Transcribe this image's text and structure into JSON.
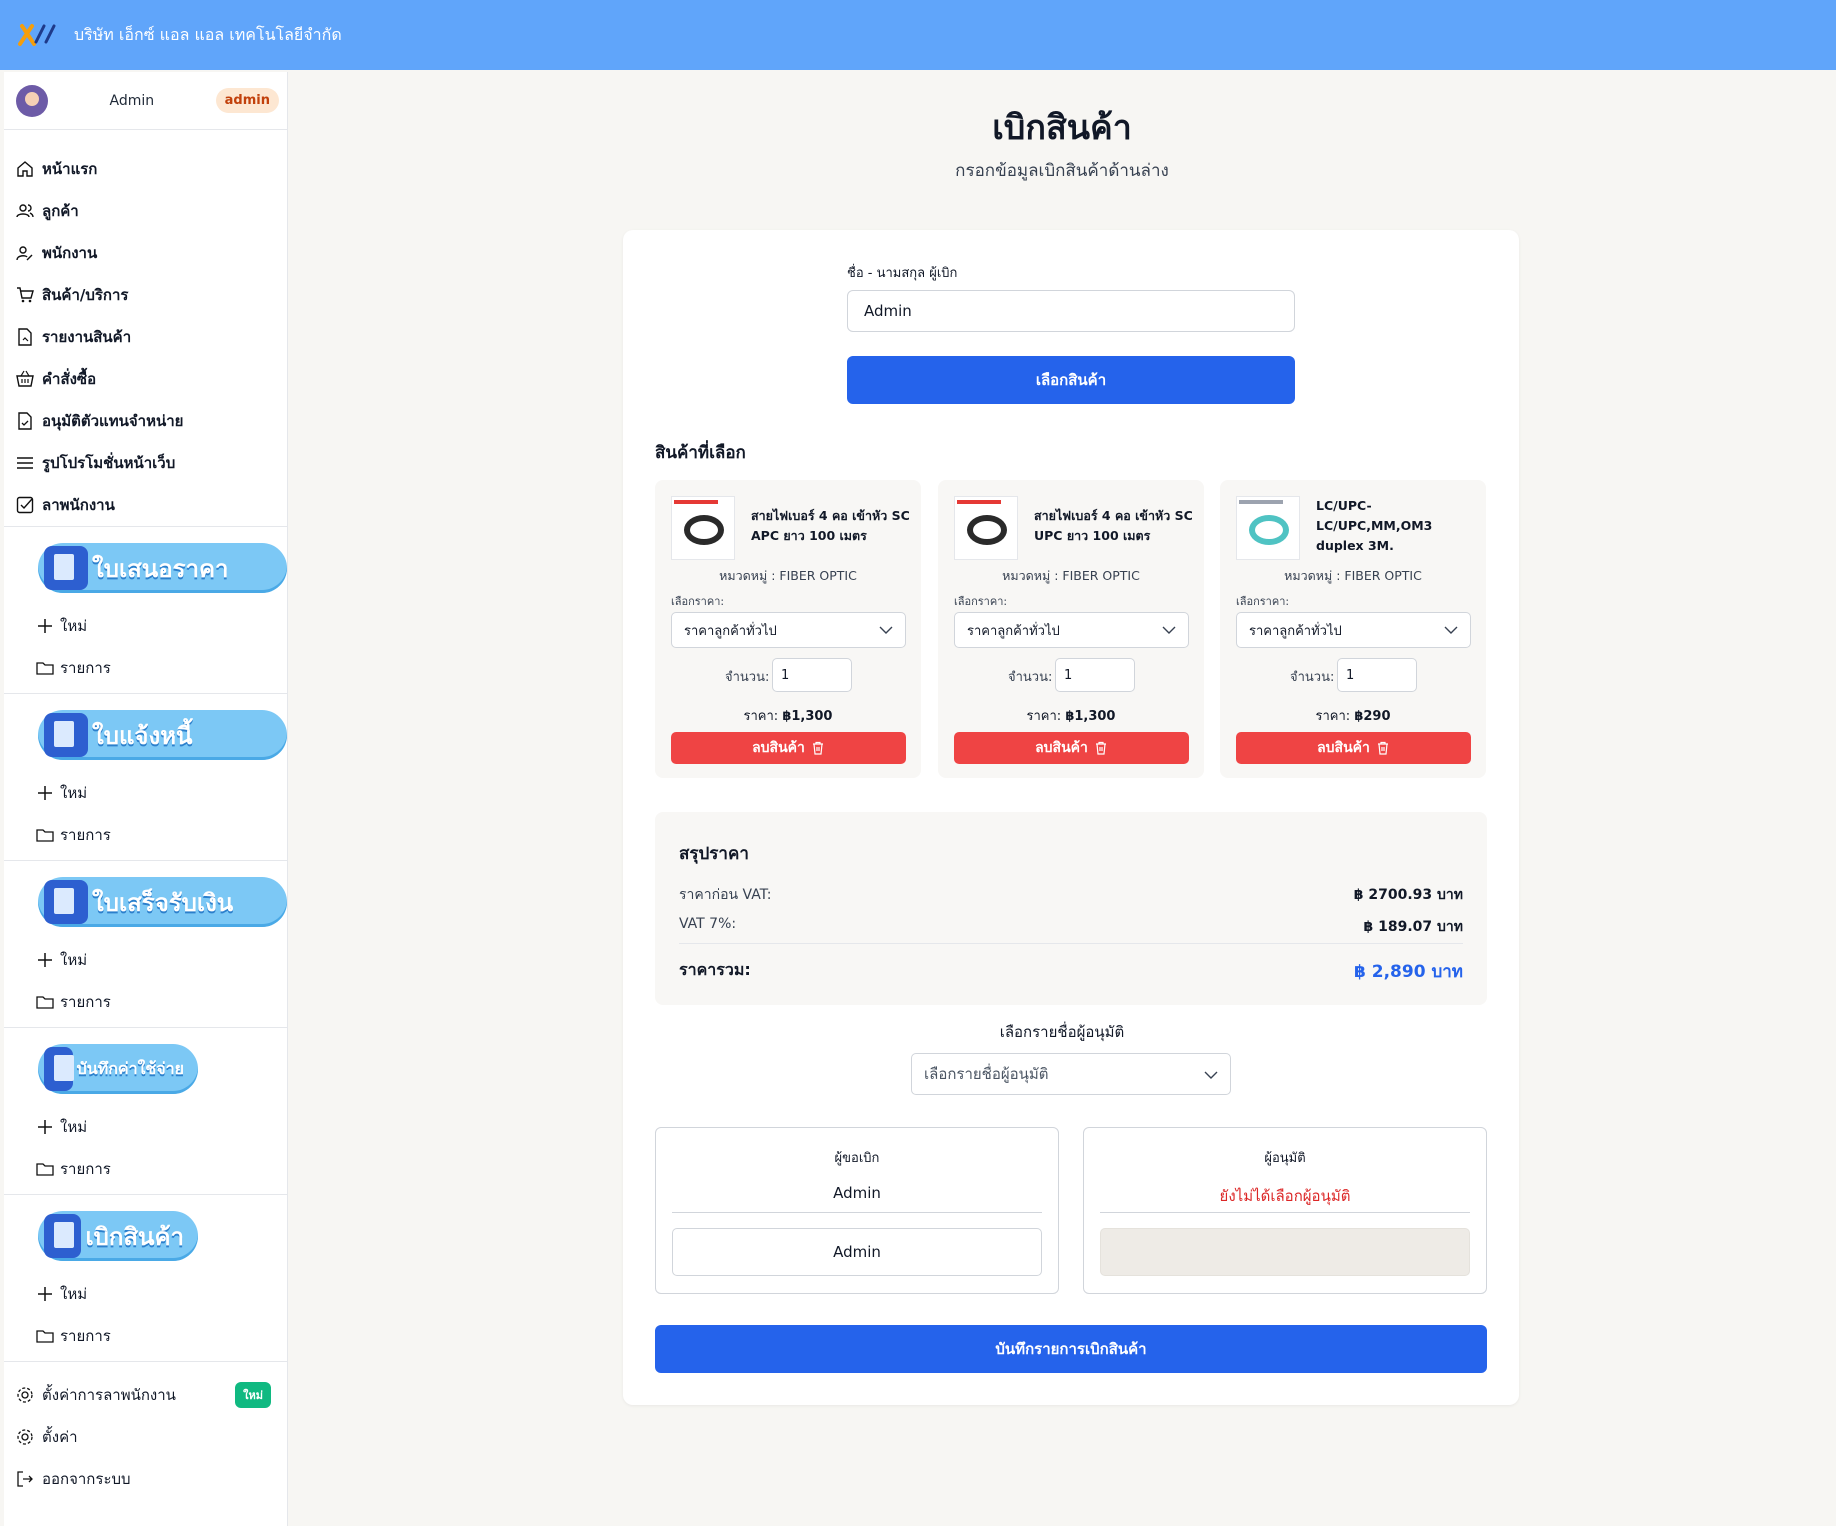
{
  "header": {
    "company_name": "บริษัท เอ็กซ์ แอล แอล เทคโนโลยีจำกัด"
  },
  "sidebar": {
    "user": {
      "name": "Admin",
      "role": "admin"
    },
    "nav": [
      {
        "label": "หน้าแรก",
        "icon": "home-icon"
      },
      {
        "label": "ลูกค้า",
        "icon": "users-icon"
      },
      {
        "label": "พนักงาน",
        "icon": "user-edit-icon"
      },
      {
        "label": "สินค้า/บริการ",
        "icon": "cart-icon"
      },
      {
        "label": "รายงานสินค้า",
        "icon": "file-report-icon"
      },
      {
        "label": "คำสั่งซื้อ",
        "icon": "basket-icon"
      },
      {
        "label": "อนุมัติตัวแทนจำหน่าย",
        "icon": "file-check-icon"
      },
      {
        "label": "รูปโปรโมชั่นหน้าเว็บ",
        "icon": "menu-icon"
      },
      {
        "label": "ลาพนักงาน",
        "icon": "checkbox-icon"
      }
    ],
    "sections": [
      {
        "banner": "ใบเสนอราคา",
        "new_label": "ใหม่",
        "list_label": "รายการ"
      },
      {
        "banner": "ใบแจ้งหนี้",
        "new_label": "ใหม่",
        "list_label": "รายการ"
      },
      {
        "banner": "ใบเสร็จรับเงิน",
        "new_label": "ใหม่",
        "list_label": "รายการ"
      },
      {
        "banner": "บันทึกค่าใช้จ่าย",
        "new_label": "ใหม่",
        "list_label": "รายการ"
      },
      {
        "banner": "เบิกสินค้า",
        "new_label": "ใหม่",
        "list_label": "รายการ"
      }
    ],
    "bottom": {
      "leave_settings": "ตั้งค่าการลาพนักงาน",
      "new_badge": "ใหม่",
      "settings": "ตั้งค่า",
      "logout": "ออกจากระบบ"
    }
  },
  "main": {
    "title": "เบิกสินค้า",
    "subtitle": "กรอกข้อมูลเบิกสินค้าด้านล่าง",
    "requester_label": "ชื่อ - นามสกุล ผู้เบิก",
    "requester_value": "Admin",
    "select_products_button": "เลือกสินค้า",
    "selected_title": "สินค้าที่เลือก",
    "products": [
      {
        "name": "สายไฟเบอร์ 4 คอ เข้าหัว SC APC ยาว 100 เมตร",
        "category": "หมวดหมู่ : FIBER OPTIC",
        "price_label": "เลือกราคา:",
        "price_option": "ราคาลูกค้าทั่วไป",
        "qty_label": "จำนวน:",
        "qty": "1",
        "price_prefix": "ราคา:",
        "price": "฿1,300",
        "delete_label": "ลบสินค้า"
      },
      {
        "name": "สายไฟเบอร์ 4 คอ เข้าหัว SC UPC ยาว 100 เมตร",
        "category": "หมวดหมู่ : FIBER OPTIC",
        "price_label": "เลือกราคา:",
        "price_option": "ราคาลูกค้าทั่วไป",
        "qty_label": "จำนวน:",
        "qty": "1",
        "price_prefix": "ราคา:",
        "price": "฿1,300",
        "delete_label": "ลบสินค้า"
      },
      {
        "name": "LC/UPC-LC/UPC,MM,OM3 duplex 3M.",
        "category": "หมวดหมู่ : FIBER OPTIC",
        "price_label": "เลือกราคา:",
        "price_option": "ราคาลูกค้าทั่วไป",
        "qty_label": "จำนวน:",
        "qty": "1",
        "price_prefix": "ราคา:",
        "price": "฿290",
        "delete_label": "ลบสินค้า"
      }
    ],
    "summary": {
      "title": "สรุปราคา",
      "before_vat_label": "ราคาก่อน VAT:",
      "before_vat_value": "฿ 2700.93 บาท",
      "vat_label": "VAT 7%:",
      "vat_value": "฿ 189.07 บาท",
      "total_label": "ราคารวม:",
      "total_value": "฿ 2,890 บาท"
    },
    "approver_select_label": "เลือกรายชื่อผู้อนุมัติ",
    "approver_select_placeholder": "เลือกรายชื่อผู้อนุมัติ",
    "requester_box": {
      "title": "ผู้ขอเบิก",
      "name": "Admin",
      "signature": "Admin"
    },
    "approver_box": {
      "title": "ผู้อนุมัติ",
      "name": "ยังไม่ได้เลือกผู้อนุมัติ"
    },
    "save_button": "บันทึกรายการเบิกสินค้า"
  },
  "colors": {
    "header": "#60a5fa",
    "primary": "#2563eb",
    "danger": "#ef4444",
    "badge_new": "#10b981"
  }
}
